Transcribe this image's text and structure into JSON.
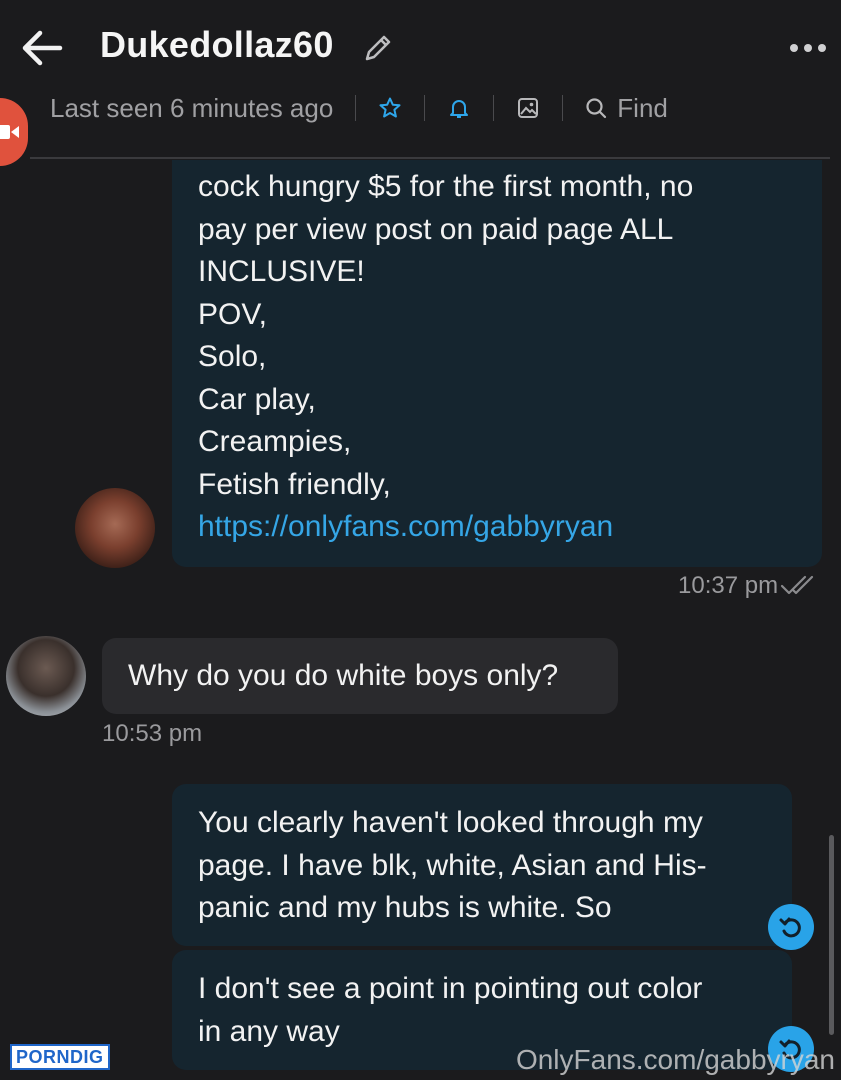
{
  "header": {
    "title": "Dukedollaz60",
    "last_seen": "Last seen 6 minutes ago",
    "find_label": "Find"
  },
  "messages": [
    {
      "direction": "outgoing",
      "lines": [
        "cock hungry $5 for the first month, no",
        "pay per view post on paid page ALL",
        "INCLUSIVE!",
        "POV,",
        "Solo,",
        "Car play,",
        "Creampies,",
        "Fetish friendly,"
      ],
      "link": "https://onlyfans.com/gabbyryan",
      "time": "10:37 pm"
    },
    {
      "direction": "incoming",
      "text": "Why do you do white boys only?",
      "time": "10:53 pm"
    },
    {
      "direction": "outgoing",
      "lines": [
        "You clearly haven't looked through my",
        "page. I have blk, white, Asian and His-",
        "panic and my hubs is white. So"
      ]
    },
    {
      "direction": "outgoing",
      "lines": [
        "I don't see a point in pointing out color",
        "in any way"
      ]
    }
  ],
  "watermark": "OnlyFans.com/gabbyryan",
  "brand_badge": "PORNDIG",
  "colors": {
    "background": "#1b1b1d",
    "outgoing_bubble": "#15252f",
    "incoming_bubble": "#2a2a2d",
    "accent": "#29a3e8",
    "link": "#35a6e6"
  },
  "icons": [
    "back-arrow-icon",
    "pencil-icon",
    "more-dots-icon",
    "star-icon",
    "bell-icon",
    "image-icon",
    "search-icon",
    "video-icon",
    "double-check-icon",
    "reply-icon"
  ]
}
